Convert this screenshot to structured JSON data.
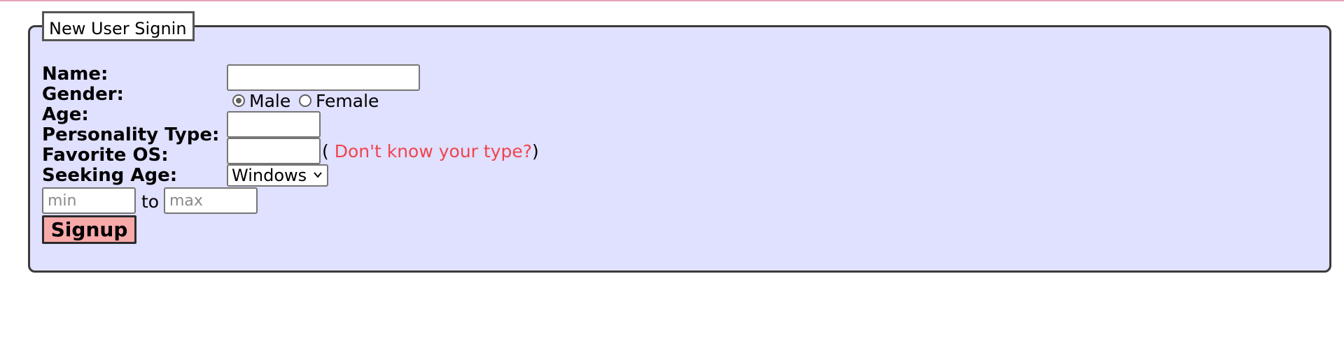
{
  "form": {
    "legend": "New User Signin",
    "labels": {
      "name": "Name:",
      "gender": "Gender:",
      "age": "Age:",
      "personality": "Personality Type:",
      "os": "Favorite OS:",
      "seeking": "Seeking Age:"
    },
    "fields": {
      "name_value": "",
      "age_value": "",
      "personality_value": "",
      "min_placeholder": "min",
      "max_placeholder": "max"
    },
    "gender_options": [
      {
        "label": "Male",
        "selected": true
      },
      {
        "label": "Female",
        "selected": false
      }
    ],
    "help": {
      "open_paren": "(",
      "link_text": "Don't know your type?",
      "close_paren": ")"
    },
    "os_select": {
      "selected": "Windows",
      "icon": "chevron-down-icon"
    },
    "range_to": "to",
    "submit_label": "Signup"
  },
  "colors": {
    "panel_background": "#e0e0ff",
    "link": "#f0444d",
    "button_background": "#f8a9a9",
    "top_rule": "#e7a3b8"
  }
}
